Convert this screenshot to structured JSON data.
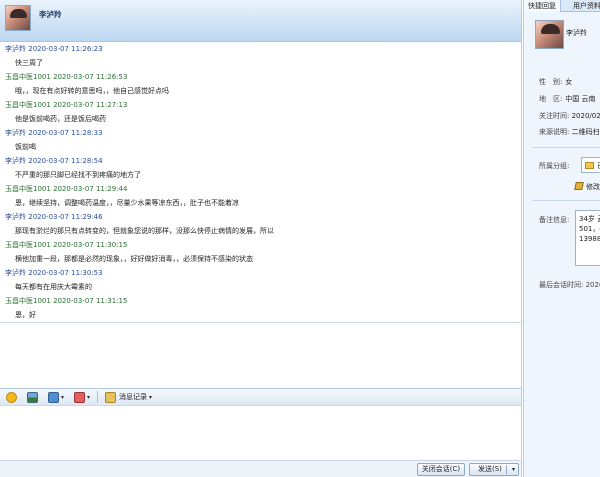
{
  "chat": {
    "title": "李泸羚",
    "messages": [
      {
        "sender": "李泸羚",
        "time": "2020-03-07 11:26:23",
        "text": "快三周了",
        "role": "other"
      },
      {
        "sender": "玉昌中医1001",
        "time": "2020-03-07 11:26:53",
        "text": "哦，，现在有点好转的意思吗，，他自己感觉好点吗",
        "role": "self"
      },
      {
        "sender": "玉昌中医1001",
        "time": "2020-03-07 11:27:13",
        "text": "他是饭前喝药，还是饭后喝药",
        "role": "self"
      },
      {
        "sender": "李泸羚",
        "time": "2020-03-07 11:28:33",
        "text": "饭前喝",
        "role": "other"
      },
      {
        "sender": "李泸羚",
        "time": "2020-03-07 11:28:54",
        "text": "不严重的那只脚已经找不到疼痛的地方了",
        "role": "other"
      },
      {
        "sender": "玉昌中医1001",
        "time": "2020-03-07 11:29:44",
        "text": "恩，继续坚持，调整喝药温度，，尽量少水果等凉东西，，肚子也不能着凉",
        "role": "self"
      },
      {
        "sender": "李泸羚",
        "time": "2020-03-07 11:29:46",
        "text": "那现有淤烂的那只有点转变的，但就象您说的那样，没那么快停止病情的发展，所以",
        "role": "other"
      },
      {
        "sender": "玉昌中医1001",
        "time": "2020-03-07 11:30:15",
        "text": "横他加重一段，那都是必然的现象，，好好做好消毒，，必须保持不感染的状态",
        "role": "self"
      },
      {
        "sender": "李泸羚",
        "time": "2020-03-07 11:30:53",
        "text": "每天都有在用庆大霉素的",
        "role": "other"
      },
      {
        "sender": "玉昌中医1001",
        "time": "2020-03-07 11:31:15",
        "text": "恩，好",
        "role": "self"
      }
    ]
  },
  "toolbar": {
    "history_label": "消息记录"
  },
  "buttons": {
    "close_label": "关闭会话(C)",
    "send_label": "发送(S)"
  },
  "side": {
    "tabs": [
      "快捷回复",
      "用户资料"
    ],
    "name": "李泸羚",
    "gender_label": "性　别:",
    "gender_value": "女",
    "region_label": "地　区:",
    "region_value": "中国 云南",
    "follow_label": "关注时间:",
    "follow_value": "2020/02",
    "source_label": "来源说明:",
    "source_value": "二维码扫",
    "group_label": "所属分组:",
    "group_value": "已成",
    "edit_label": "修改",
    "remark_label": "备注信息:",
    "remark_value": "34岁 云\n501，4\n139886",
    "last_label": "最后会话时间:",
    "last_value": "2020"
  }
}
